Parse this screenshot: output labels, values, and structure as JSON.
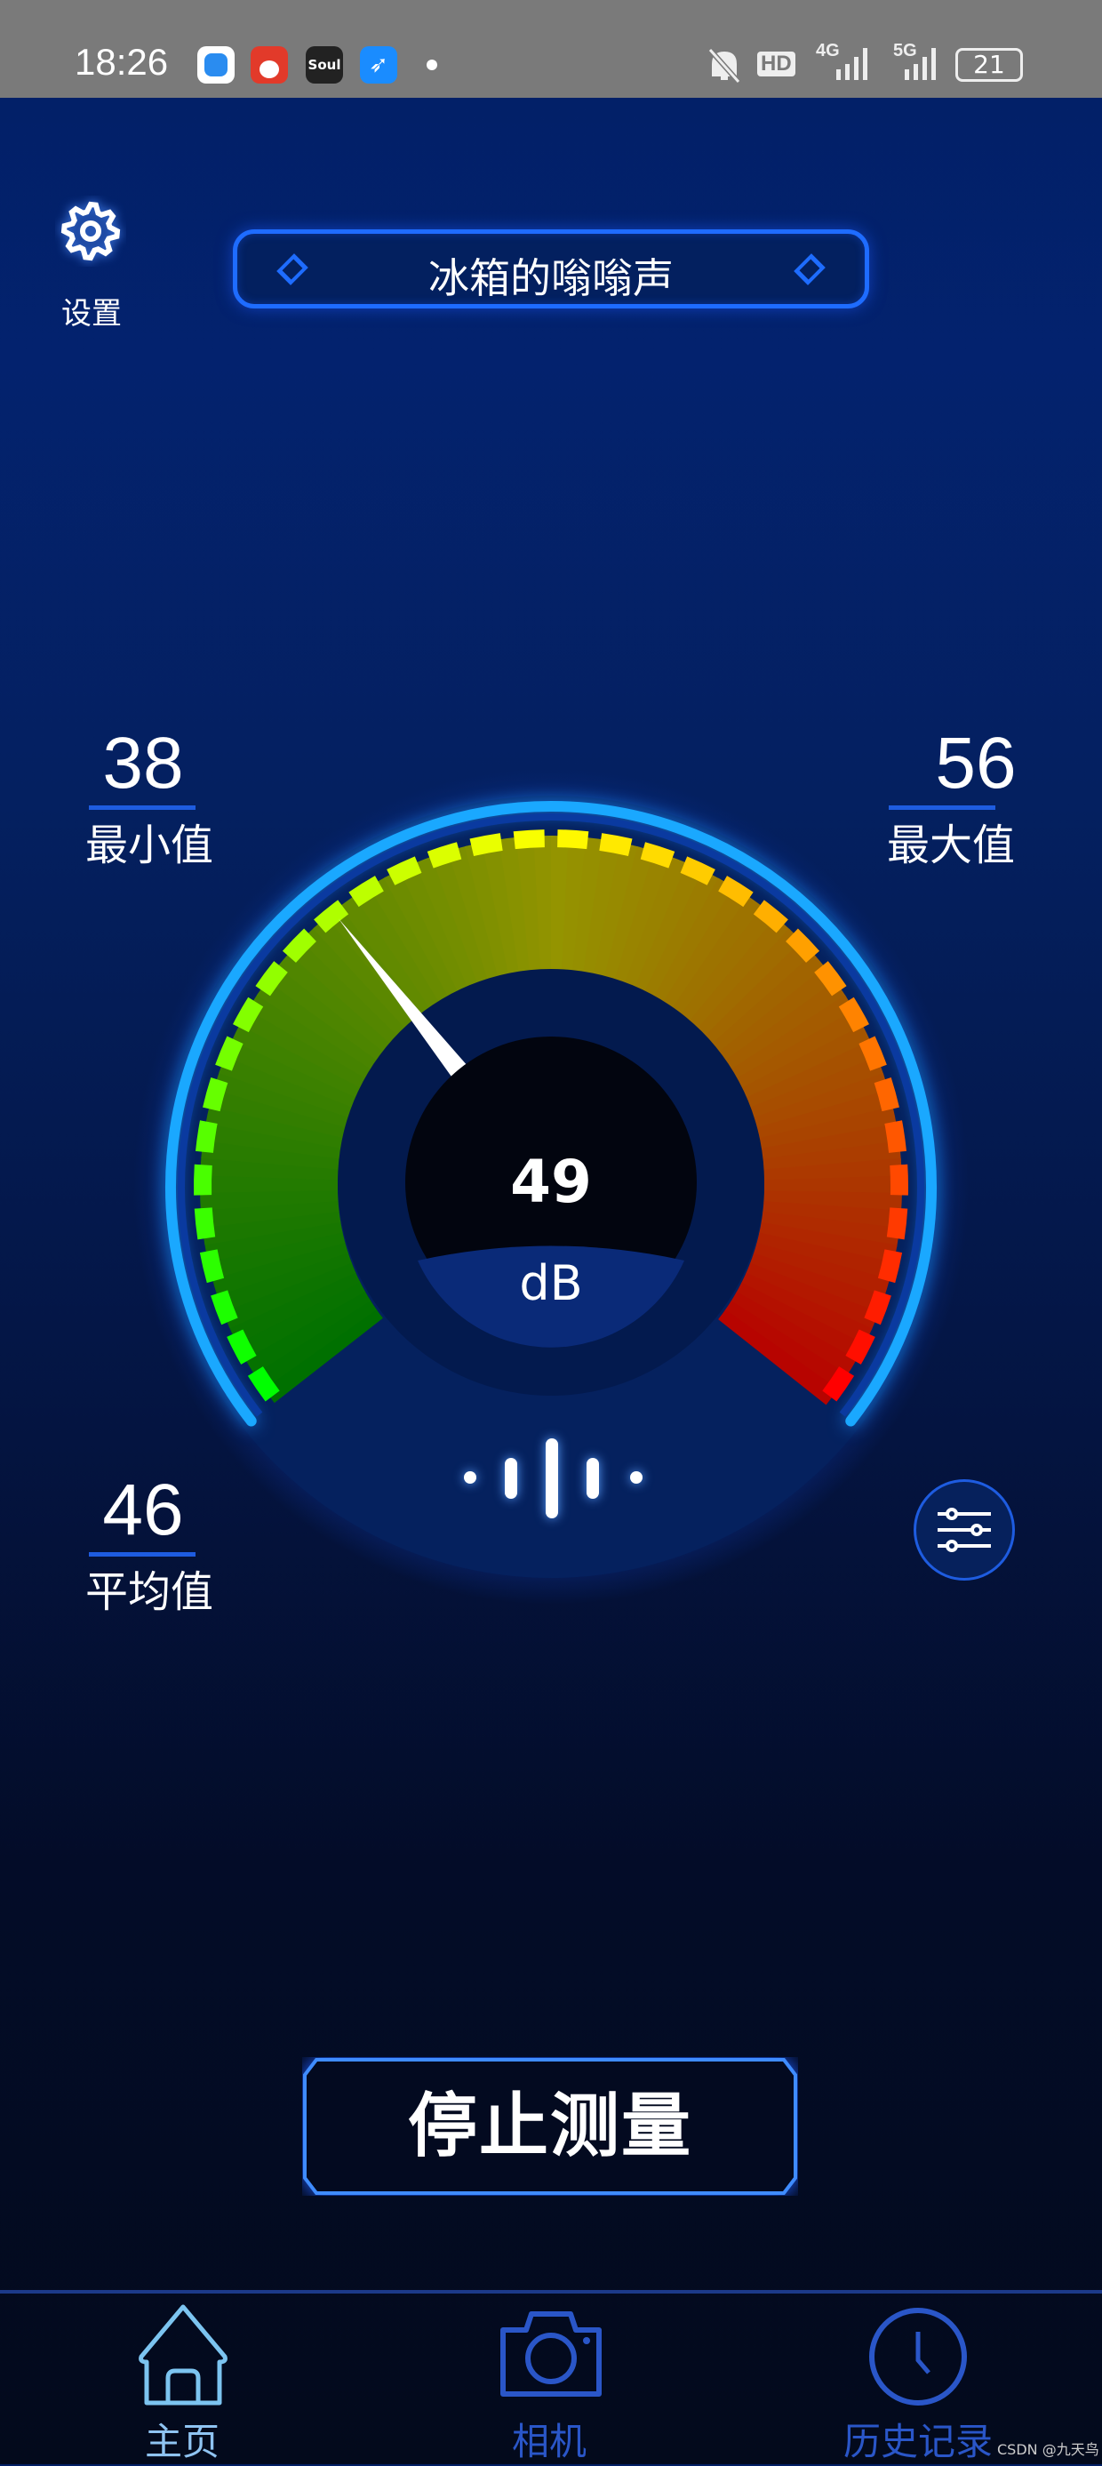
{
  "status_bar": {
    "time": "18:26",
    "network_4g": "4G",
    "network_5g": "5G",
    "hd": "HD",
    "battery": "21",
    "icons": [
      "app-icon-blue",
      "app-icon-red",
      "app-icon-soul",
      "app-icon-feather",
      "notification-dot",
      "mute-bell-icon",
      "hd-icon",
      "signal-4g-icon",
      "signal-5g-icon",
      "battery-icon"
    ],
    "soul_label": "Soul"
  },
  "header": {
    "settings_label": "设置",
    "title": "冰箱的嗡嗡声"
  },
  "stats": {
    "min": {
      "value": "38",
      "label": "最小值"
    },
    "max": {
      "value": "56",
      "label": "最大值"
    },
    "avg": {
      "value": "46",
      "label": "平均值"
    }
  },
  "gauge": {
    "value": "49",
    "unit": "dB",
    "colors": {
      "low": "#22ff22",
      "mid": "#ffee00",
      "high": "#ff1010",
      "ring": "#1aa8ff"
    }
  },
  "actions": {
    "stop_label": "停止测量"
  },
  "nav": {
    "items": [
      {
        "label": "主页",
        "icon": "home-icon",
        "active": true
      },
      {
        "label": "相机",
        "icon": "camera-icon",
        "active": false
      },
      {
        "label": "历史记录",
        "icon": "clock-icon",
        "active": false
      }
    ]
  },
  "watermark": "CSDN @九天鸟",
  "colors": {
    "accent": "#1e6cff",
    "nav_active": "#7cc4f0",
    "nav_inactive": "#2a56c8"
  }
}
